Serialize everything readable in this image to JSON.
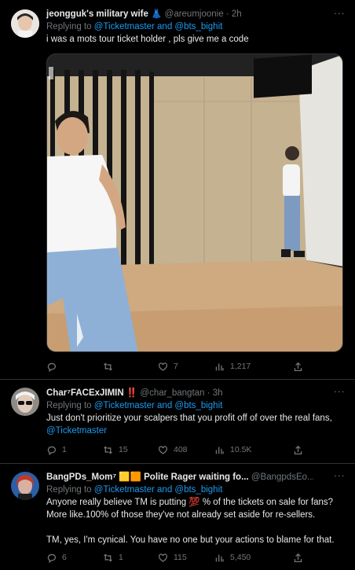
{
  "tweets": [
    {
      "name": "jeongguk's military wife",
      "emoji": "👗",
      "handle": "@areumjoonie",
      "time": "2h",
      "reply_prefix": "Replying to",
      "mention1": "@Ticketmaster",
      "reply_and": "and",
      "mention2": "@bts_bighit",
      "text": "i was a mots tour ticket holder , pls give me a code",
      "replies": "",
      "retweets": "",
      "likes": "7",
      "views": "1,217"
    },
    {
      "name": "Char⁷FACExJIMIN",
      "emoji": "‼️",
      "handle": "@char_bangtan",
      "time": "3h",
      "reply_prefix": "Replying to",
      "mention1": "@Ticketmaster",
      "reply_and": "and",
      "mention2": "@bts_bighit",
      "text": "Just don't prioritize your scalpers that you profit off of over the real fans,",
      "text_link": "@Ticketmaster",
      "replies": "1",
      "retweets": "15",
      "likes": "408",
      "views": "10.5K"
    },
    {
      "name": "BangPDs_Mom⁷ 🟨🟧 Polite Rager waiting fo...",
      "handle": "@BangpdsEo...",
      "time": "3h",
      "reply_prefix": "Replying to",
      "mention1": "@Ticketmaster",
      "reply_and": "and",
      "mention2": "@bts_bighit",
      "text_line1a": "Anyone really believe TM is putting",
      "text_emoji": "💯",
      "text_line1b": "% of the tickets on sale for fans?",
      "text_line2": "More  like.100% of those they've not already set aside for re-sellers.",
      "text_line3": "TM, yes, I'm cynical. You have no one but your actions to blame for that.",
      "replies": "6",
      "retweets": "1",
      "likes": "115",
      "views": "5,450"
    }
  ],
  "colors": {
    "background": "#000000",
    "text": "#e7e9ea",
    "muted": "#71767b",
    "link": "#1d9bf0",
    "divider": "#2f3336"
  }
}
